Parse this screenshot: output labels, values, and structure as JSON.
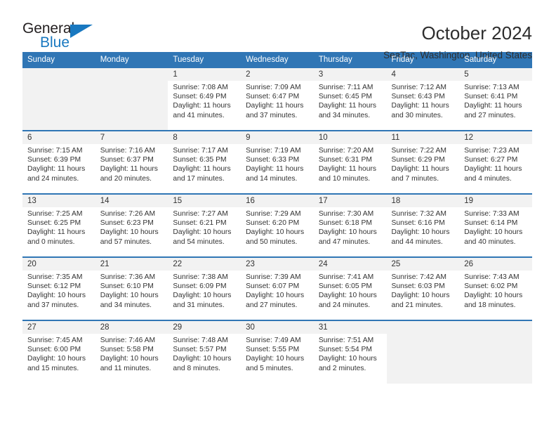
{
  "brand": {
    "name_part1": "General",
    "name_part2": "Blue",
    "accent_color": "#1878c0",
    "triangle_icon": "triangle-icon"
  },
  "header": {
    "month_title": "October 2024",
    "location": "SeaTac, Washington, United States"
  },
  "theme": {
    "header_blue": "#3076b5",
    "daynum_bg": "#f2f2f2",
    "text": "#333333"
  },
  "weekday_headers": [
    "Sunday",
    "Monday",
    "Tuesday",
    "Wednesday",
    "Thursday",
    "Friday",
    "Saturday"
  ],
  "labels": {
    "sunrise_prefix": "Sunrise:",
    "sunset_prefix": "Sunset:",
    "daylight_prefix": "Daylight:"
  },
  "weeks": [
    {
      "days": [
        {
          "num": "",
          "empty": true
        },
        {
          "num": "",
          "empty": true
        },
        {
          "num": "1",
          "sunrise": "Sunrise: 7:08 AM",
          "sunset": "Sunset: 6:49 PM",
          "daylight1": "Daylight: 11 hours",
          "daylight2": "and 41 minutes."
        },
        {
          "num": "2",
          "sunrise": "Sunrise: 7:09 AM",
          "sunset": "Sunset: 6:47 PM",
          "daylight1": "Daylight: 11 hours",
          "daylight2": "and 37 minutes."
        },
        {
          "num": "3",
          "sunrise": "Sunrise: 7:11 AM",
          "sunset": "Sunset: 6:45 PM",
          "daylight1": "Daylight: 11 hours",
          "daylight2": "and 34 minutes."
        },
        {
          "num": "4",
          "sunrise": "Sunrise: 7:12 AM",
          "sunset": "Sunset: 6:43 PM",
          "daylight1": "Daylight: 11 hours",
          "daylight2": "and 30 minutes."
        },
        {
          "num": "5",
          "sunrise": "Sunrise: 7:13 AM",
          "sunset": "Sunset: 6:41 PM",
          "daylight1": "Daylight: 11 hours",
          "daylight2": "and 27 minutes."
        }
      ]
    },
    {
      "days": [
        {
          "num": "6",
          "sunrise": "Sunrise: 7:15 AM",
          "sunset": "Sunset: 6:39 PM",
          "daylight1": "Daylight: 11 hours",
          "daylight2": "and 24 minutes."
        },
        {
          "num": "7",
          "sunrise": "Sunrise: 7:16 AM",
          "sunset": "Sunset: 6:37 PM",
          "daylight1": "Daylight: 11 hours",
          "daylight2": "and 20 minutes."
        },
        {
          "num": "8",
          "sunrise": "Sunrise: 7:17 AM",
          "sunset": "Sunset: 6:35 PM",
          "daylight1": "Daylight: 11 hours",
          "daylight2": "and 17 minutes."
        },
        {
          "num": "9",
          "sunrise": "Sunrise: 7:19 AM",
          "sunset": "Sunset: 6:33 PM",
          "daylight1": "Daylight: 11 hours",
          "daylight2": "and 14 minutes."
        },
        {
          "num": "10",
          "sunrise": "Sunrise: 7:20 AM",
          "sunset": "Sunset: 6:31 PM",
          "daylight1": "Daylight: 11 hours",
          "daylight2": "and 10 minutes."
        },
        {
          "num": "11",
          "sunrise": "Sunrise: 7:22 AM",
          "sunset": "Sunset: 6:29 PM",
          "daylight1": "Daylight: 11 hours",
          "daylight2": "and 7 minutes."
        },
        {
          "num": "12",
          "sunrise": "Sunrise: 7:23 AM",
          "sunset": "Sunset: 6:27 PM",
          "daylight1": "Daylight: 11 hours",
          "daylight2": "and 4 minutes."
        }
      ]
    },
    {
      "days": [
        {
          "num": "13",
          "sunrise": "Sunrise: 7:25 AM",
          "sunset": "Sunset: 6:25 PM",
          "daylight1": "Daylight: 11 hours",
          "daylight2": "and 0 minutes."
        },
        {
          "num": "14",
          "sunrise": "Sunrise: 7:26 AM",
          "sunset": "Sunset: 6:23 PM",
          "daylight1": "Daylight: 10 hours",
          "daylight2": "and 57 minutes."
        },
        {
          "num": "15",
          "sunrise": "Sunrise: 7:27 AM",
          "sunset": "Sunset: 6:21 PM",
          "daylight1": "Daylight: 10 hours",
          "daylight2": "and 54 minutes."
        },
        {
          "num": "16",
          "sunrise": "Sunrise: 7:29 AM",
          "sunset": "Sunset: 6:20 PM",
          "daylight1": "Daylight: 10 hours",
          "daylight2": "and 50 minutes."
        },
        {
          "num": "17",
          "sunrise": "Sunrise: 7:30 AM",
          "sunset": "Sunset: 6:18 PM",
          "daylight1": "Daylight: 10 hours",
          "daylight2": "and 47 minutes."
        },
        {
          "num": "18",
          "sunrise": "Sunrise: 7:32 AM",
          "sunset": "Sunset: 6:16 PM",
          "daylight1": "Daylight: 10 hours",
          "daylight2": "and 44 minutes."
        },
        {
          "num": "19",
          "sunrise": "Sunrise: 7:33 AM",
          "sunset": "Sunset: 6:14 PM",
          "daylight1": "Daylight: 10 hours",
          "daylight2": "and 40 minutes."
        }
      ]
    },
    {
      "days": [
        {
          "num": "20",
          "sunrise": "Sunrise: 7:35 AM",
          "sunset": "Sunset: 6:12 PM",
          "daylight1": "Daylight: 10 hours",
          "daylight2": "and 37 minutes."
        },
        {
          "num": "21",
          "sunrise": "Sunrise: 7:36 AM",
          "sunset": "Sunset: 6:10 PM",
          "daylight1": "Daylight: 10 hours",
          "daylight2": "and 34 minutes."
        },
        {
          "num": "22",
          "sunrise": "Sunrise: 7:38 AM",
          "sunset": "Sunset: 6:09 PM",
          "daylight1": "Daylight: 10 hours",
          "daylight2": "and 31 minutes."
        },
        {
          "num": "23",
          "sunrise": "Sunrise: 7:39 AM",
          "sunset": "Sunset: 6:07 PM",
          "daylight1": "Daylight: 10 hours",
          "daylight2": "and 27 minutes."
        },
        {
          "num": "24",
          "sunrise": "Sunrise: 7:41 AM",
          "sunset": "Sunset: 6:05 PM",
          "daylight1": "Daylight: 10 hours",
          "daylight2": "and 24 minutes."
        },
        {
          "num": "25",
          "sunrise": "Sunrise: 7:42 AM",
          "sunset": "Sunset: 6:03 PM",
          "daylight1": "Daylight: 10 hours",
          "daylight2": "and 21 minutes."
        },
        {
          "num": "26",
          "sunrise": "Sunrise: 7:43 AM",
          "sunset": "Sunset: 6:02 PM",
          "daylight1": "Daylight: 10 hours",
          "daylight2": "and 18 minutes."
        }
      ]
    },
    {
      "days": [
        {
          "num": "27",
          "sunrise": "Sunrise: 7:45 AM",
          "sunset": "Sunset: 6:00 PM",
          "daylight1": "Daylight: 10 hours",
          "daylight2": "and 15 minutes."
        },
        {
          "num": "28",
          "sunrise": "Sunrise: 7:46 AM",
          "sunset": "Sunset: 5:58 PM",
          "daylight1": "Daylight: 10 hours",
          "daylight2": "and 11 minutes."
        },
        {
          "num": "29",
          "sunrise": "Sunrise: 7:48 AM",
          "sunset": "Sunset: 5:57 PM",
          "daylight1": "Daylight: 10 hours",
          "daylight2": "and 8 minutes."
        },
        {
          "num": "30",
          "sunrise": "Sunrise: 7:49 AM",
          "sunset": "Sunset: 5:55 PM",
          "daylight1": "Daylight: 10 hours",
          "daylight2": "and 5 minutes."
        },
        {
          "num": "31",
          "sunrise": "Sunrise: 7:51 AM",
          "sunset": "Sunset: 5:54 PM",
          "daylight1": "Daylight: 10 hours",
          "daylight2": "and 2 minutes."
        },
        {
          "num": "",
          "empty": true
        },
        {
          "num": "",
          "empty": true
        }
      ]
    }
  ]
}
